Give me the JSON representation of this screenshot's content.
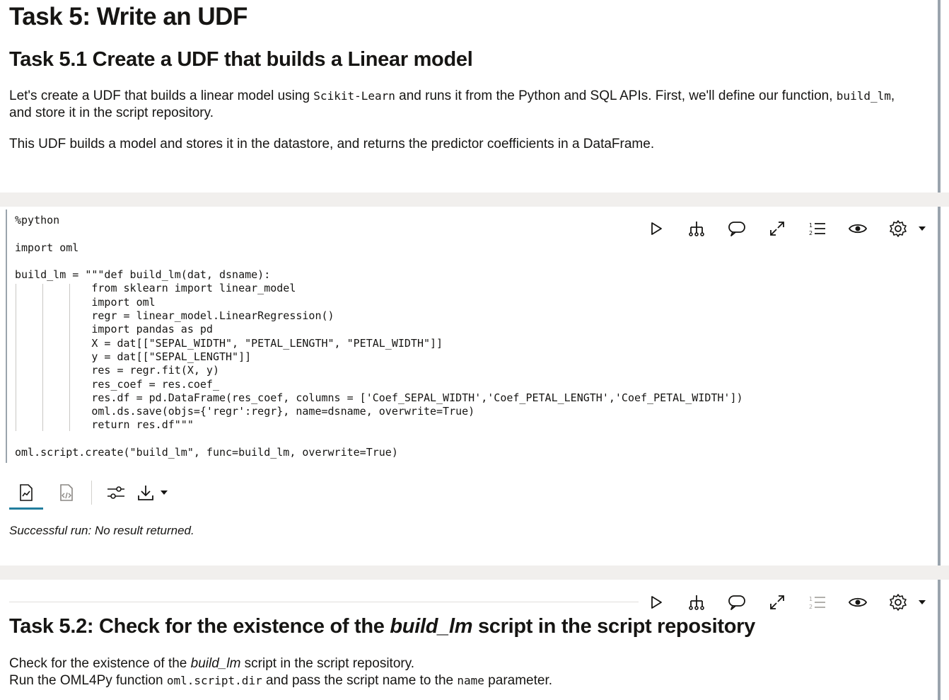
{
  "para1": {
    "title": "Task 5: Write an UDF",
    "subtitle": "Task 5.1 Create a UDF that builds a Linear model",
    "p1_a": "Let's create a UDF that builds a linear model using ",
    "p1_code1": "Scikit-Learn",
    "p1_b": " and runs it from the Python and SQL APIs. First, we'll define our function, ",
    "p1_code2": "build_lm",
    "p1_c": ",",
    "p1_d": "and store it in the script repository.",
    "p2": "This UDF builds a model and stores it in the datastore, and returns the predictor coefficients in a DataFrame."
  },
  "para2": {
    "code": "%python\n\nimport oml\n\nbuild_lm = \"\"\"def build_lm(dat, dsname):\n            from sklearn import linear_model\n            import oml\n            regr = linear_model.LinearRegression()\n            import pandas as pd\n            X = dat[[\"SEPAL_WIDTH\", \"PETAL_LENGTH\", \"PETAL_WIDTH\"]]\n            y = dat[[\"SEPAL_LENGTH\"]]\n            res = regr.fit(X, y)\n            res_coef = res.coef_\n            res.df = pd.DataFrame(res_coef, columns = ['Coef_SEPAL_WIDTH','Coef_PETAL_LENGTH','Coef_PETAL_WIDTH'])\n            oml.ds.save(objs={'regr':regr}, name=dsname, overwrite=True)\n            return res.df\"\"\"\n\noml.script.create(\"build_lm\", func=build_lm, overwrite=True)",
    "status": "Successful run: No result returned."
  },
  "para3": {
    "title_a": "Task 5.2: Check for the existence of the ",
    "title_em": "build_lm",
    "title_b": " script in the script repository",
    "line1_a": "Check for the existence of the ",
    "line1_em": "build_lm",
    "line1_b": " script in the script repository.",
    "line2_a": "Run the OML4Py function ",
    "line2_code": "oml.script.dir",
    "line2_b": " and pass the script name to the ",
    "line2_code2": "name",
    "line2_c": " parameter."
  },
  "icons": {
    "run": "play-icon",
    "dynamic_forms": "hierarchy-icon",
    "comments": "comment-icon",
    "expand": "expand-icon",
    "line_numbers": "line-numbers-icon",
    "visibility": "eye-icon",
    "settings": "gear-icon",
    "output_result": "chart-document-icon",
    "output_code": "code-document-icon",
    "output_settings": "sliders-icon",
    "download": "download-icon"
  },
  "colors": {
    "accent": "#227e9e",
    "text": "#161513",
    "muted": "#6f6c67"
  }
}
